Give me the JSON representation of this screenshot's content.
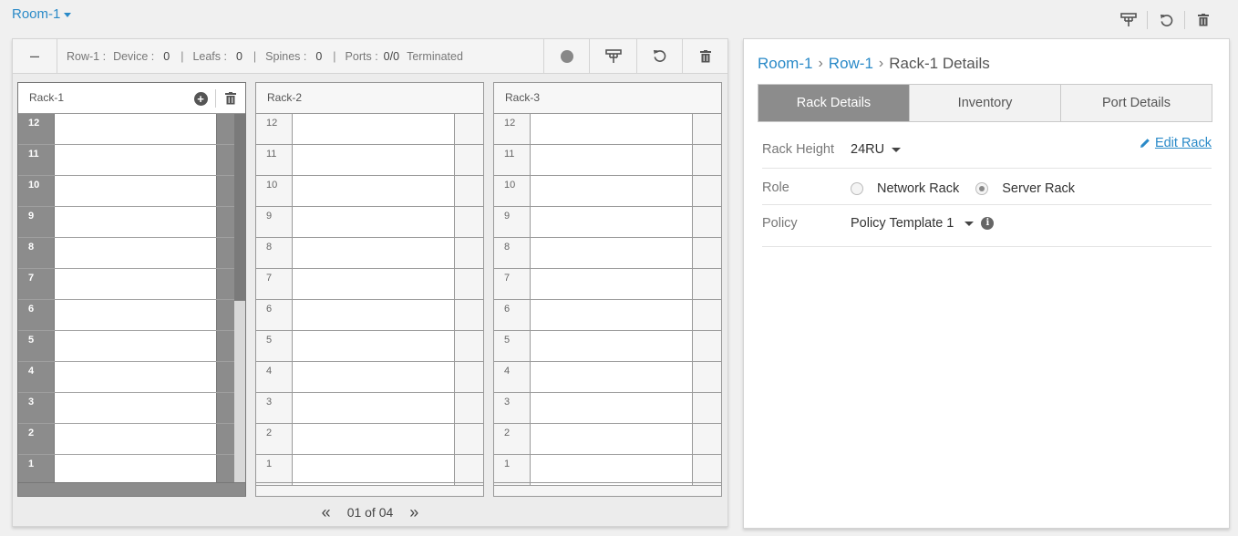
{
  "header": {
    "room_title": "Room-1"
  },
  "row_toolbar": {
    "row_label": "Row-1 :",
    "device_label": "Device :",
    "device_value": "0",
    "leafs_label": "Leafs :",
    "leafs_value": "0",
    "spines_label": "Spines :",
    "spines_value": "0",
    "ports_label": "Ports :",
    "ports_value": "0/0",
    "terminated_label": "Terminated"
  },
  "racks": [
    {
      "name": "Rack-1"
    },
    {
      "name": "Rack-2"
    },
    {
      "name": "Rack-3"
    }
  ],
  "slot_numbers": [
    "12",
    "11",
    "10",
    "9",
    "8",
    "7",
    "6",
    "5",
    "4",
    "3",
    "2",
    "1"
  ],
  "rack1_scroll_fraction": 0.49,
  "pager": {
    "text": "01 of 04"
  },
  "details": {
    "breadcrumb": [
      "Room-1",
      "Row-1",
      "Rack-1 Details"
    ],
    "tabs": [
      "Rack Details",
      "Inventory",
      "Port Details"
    ],
    "active_tab": "Rack Details",
    "edit_label": "Edit Rack",
    "rack_height_label": "Rack Height",
    "rack_height_value": "24RU",
    "role_label": "Role",
    "role_options": [
      "Network Rack",
      "Server Rack"
    ],
    "role_selected": "Server Rack",
    "policy_label": "Policy",
    "policy_value": "Policy Template 1"
  },
  "icons": {
    "room_dropdown": "caret-down-icon",
    "topology": "topology-icon",
    "reset": "reset-icon",
    "delete": "trash-icon",
    "add": "plus-circle-icon",
    "edit": "pencil-icon",
    "info": "info-icon",
    "status": "status-dot-icon"
  },
  "colors": {
    "link": "#2a8ac8",
    "selected_gray": "#8c8c8c",
    "active_tab": "#8c8c8c"
  }
}
